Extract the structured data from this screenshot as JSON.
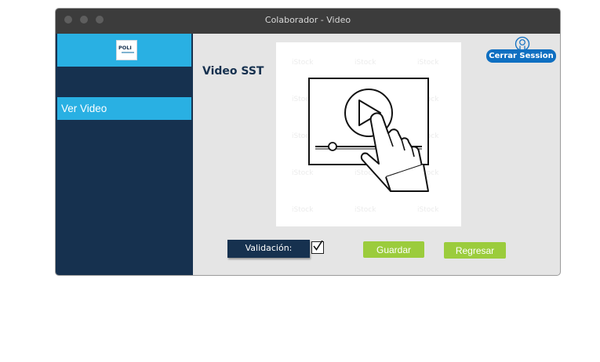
{
  "window": {
    "title": "Colaborador - Video"
  },
  "sidebar": {
    "logo_text": "POLI",
    "items": [
      {
        "label": "Ver Video",
        "active": true
      }
    ]
  },
  "main": {
    "heading": "Video SST",
    "logout_label": "Cerrar Session",
    "validation_label": "Validación:",
    "validation_checked": true,
    "save_label": "Guardar",
    "back_label": "Regresar"
  },
  "colors": {
    "sidebar_bg": "#16314f",
    "accent_blue": "#29b0e3",
    "logout_blue": "#0f6fc1",
    "button_green": "#9bcc3c",
    "content_bg": "#e5e5e5",
    "titlebar_bg": "#3c3c3c"
  },
  "icons": {
    "logout": "user-icon",
    "video": "video-play-touch-illustration"
  }
}
